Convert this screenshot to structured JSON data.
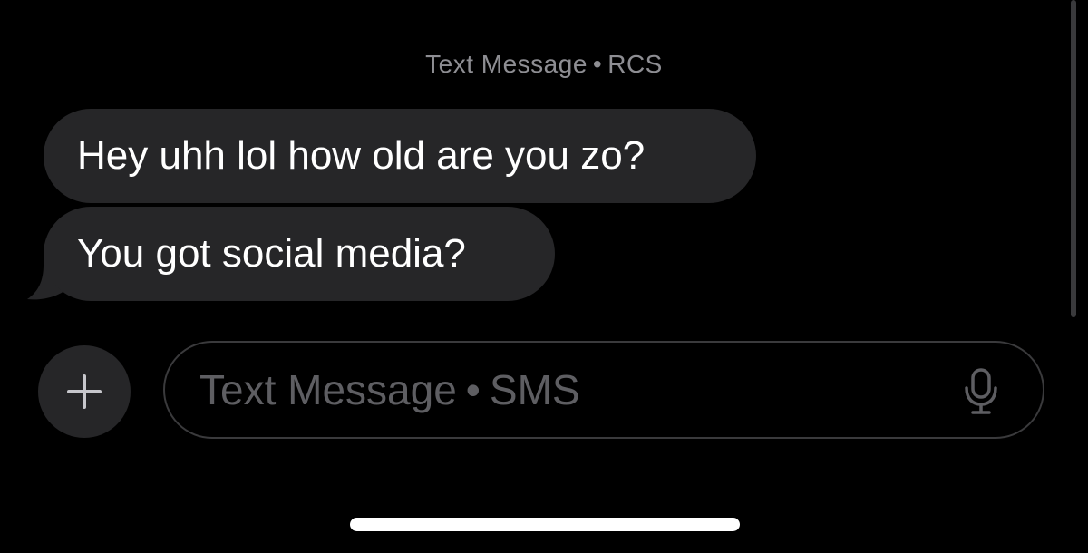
{
  "conversation": {
    "header": {
      "label": "Text Message",
      "separator": "•",
      "service": "RCS"
    },
    "messages": [
      {
        "text": "Hey uhh lol how old are you zo?",
        "direction": "incoming"
      },
      {
        "text": "You got social media?",
        "direction": "incoming"
      }
    ]
  },
  "composer": {
    "add_icon": "plus-icon",
    "placeholder_label": "Text Message",
    "placeholder_separator": "•",
    "placeholder_service": "SMS",
    "mic_icon": "microphone-icon"
  },
  "colors": {
    "background": "#000000",
    "bubble": "#262628",
    "text": "#ffffff",
    "muted": "#8e8e93",
    "placeholder": "#5e5e62",
    "border": "#3a3a3c"
  }
}
